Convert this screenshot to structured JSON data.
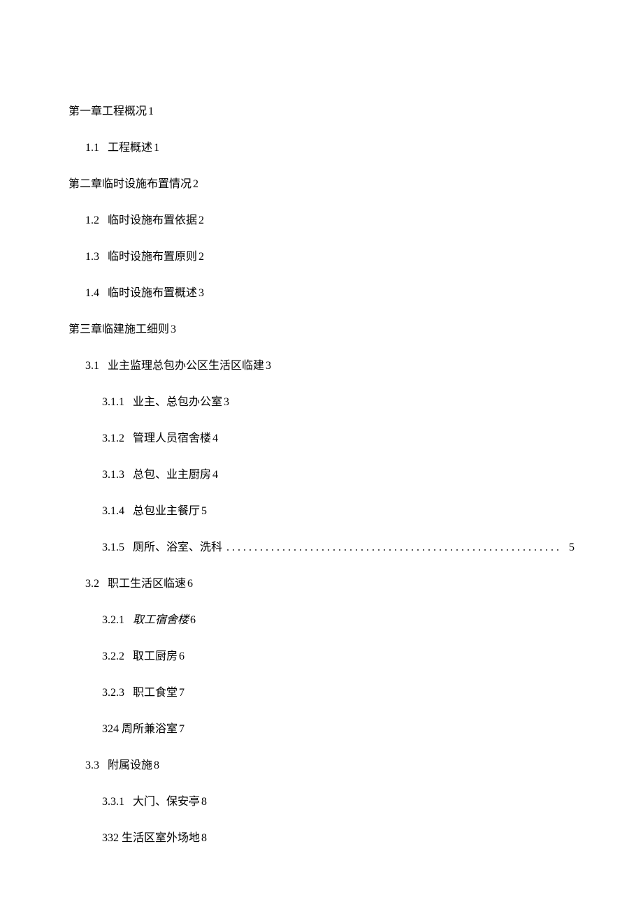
{
  "toc": [
    {
      "level": 1,
      "number": "",
      "text": "第一章工程概况",
      "page": "1",
      "hasDots": false,
      "noNumber": true
    },
    {
      "level": 2,
      "number": "1.1",
      "text": "工程概述",
      "page": "1",
      "hasDots": false
    },
    {
      "level": 1,
      "number": "",
      "text": "第二章临时设施布置情况",
      "page": "2",
      "hasDots": false,
      "noNumber": true
    },
    {
      "level": 2,
      "number": "1.2",
      "text": "临时设施布置依据",
      "page": "2",
      "hasDots": false
    },
    {
      "level": 2,
      "number": "1.3",
      "text": "临时设施布置原则",
      "page": "2",
      "hasDots": false
    },
    {
      "level": 2,
      "number": "1.4",
      "text": "临时设施布置概述",
      "page": "3",
      "hasDots": false
    },
    {
      "level": 1,
      "number": "",
      "text": "第三章临建施工细则",
      "page": "3",
      "hasDots": false,
      "noNumber": true
    },
    {
      "level": 2,
      "number": "3.1",
      "text": "业主监理总包办公区生活区临建",
      "page": "3",
      "hasDots": false
    },
    {
      "level": 3,
      "number": "3.1.1",
      "text": "业主、总包办公室",
      "page": "3",
      "hasDots": false
    },
    {
      "level": 3,
      "number": "3.1.2",
      "text": "管理人员宿舍楼",
      "page": "4",
      "hasDots": false
    },
    {
      "level": 3,
      "number": "3.1.3",
      "text": "总包、业主厨房",
      "page": "4",
      "hasDots": false
    },
    {
      "level": 3,
      "number": "3.1.4",
      "text": "总包业主餐厅",
      "page": "5",
      "hasDots": false
    },
    {
      "level": 3,
      "number": "3.1.5",
      "text": "厕所、浴室、洗科",
      "page": "5",
      "hasDots": true
    },
    {
      "level": 2,
      "number": "3.2",
      "text": "职工生活区临速",
      "page": "6",
      "hasDots": false
    },
    {
      "level": 3,
      "number": "3.2.1",
      "text": "取工宿舍楼",
      "page": "6",
      "hasDots": false,
      "italic": true
    },
    {
      "level": 3,
      "number": "3.2.2",
      "text": "取工厨房",
      "page": "6",
      "hasDots": false
    },
    {
      "level": 3,
      "number": "3.2.3",
      "text": "职工食堂",
      "page": "7",
      "hasDots": false
    },
    {
      "level": 3,
      "number": "",
      "text": "324 周所兼浴室",
      "page": "7",
      "hasDots": false,
      "noNumber": true
    },
    {
      "level": 2,
      "number": "3.3",
      "text": "附属设施",
      "page": "8",
      "hasDots": false
    },
    {
      "level": 3,
      "number": "3.3.1",
      "text": "大门、保安亭",
      "page": "8",
      "hasDots": false
    },
    {
      "level": 3,
      "number": "",
      "text": "332 生活区室外场地",
      "page": "8",
      "hasDots": false,
      "noNumber": true
    }
  ]
}
